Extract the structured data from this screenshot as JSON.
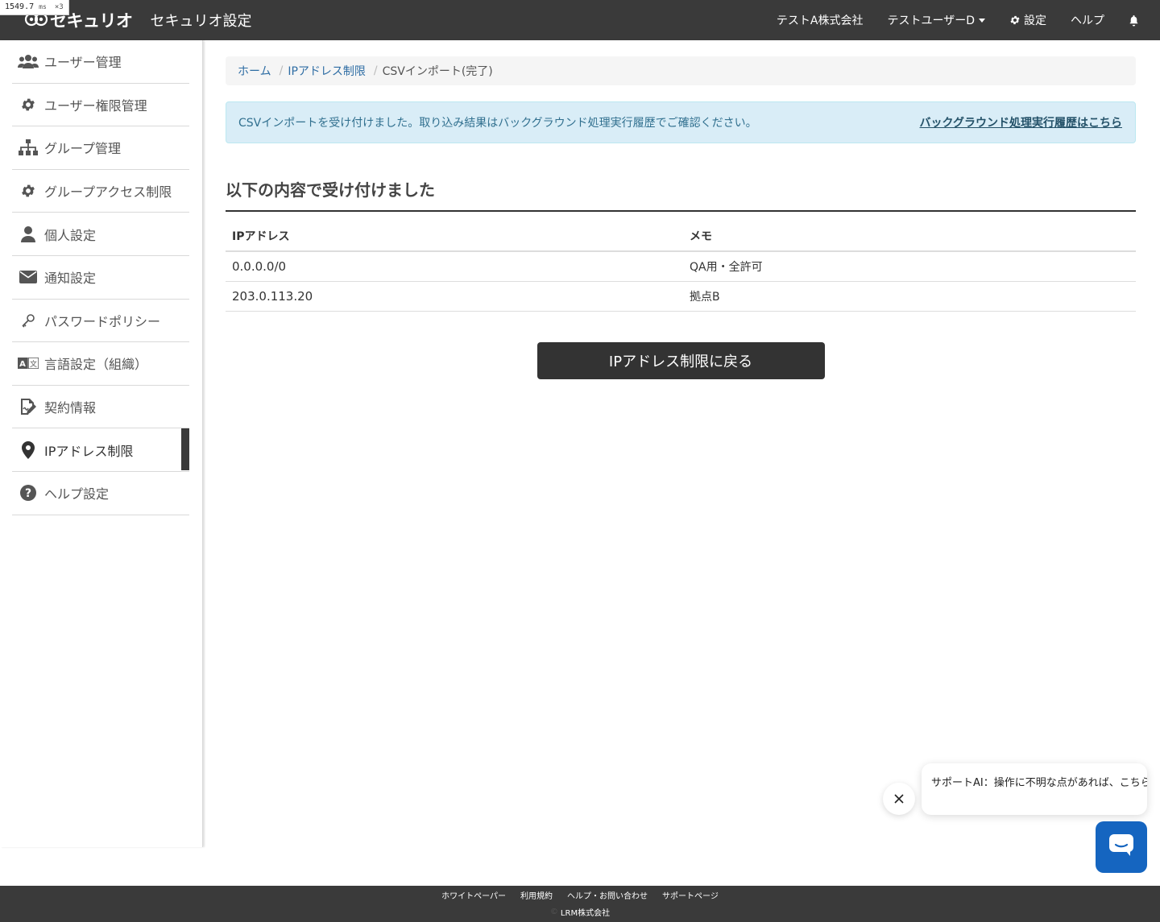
{
  "perf": {
    "value": "1549.7",
    "unit": "ms",
    "mult": "×3"
  },
  "header": {
    "brand": "セキュリオ",
    "title": "セキュリオ設定",
    "company": "テストA株式会社",
    "user": "テストユーザーD",
    "settings": "設定",
    "help": "ヘルプ",
    "icons": [
      "logo-icon",
      "gear-icon",
      "bell-icon"
    ]
  },
  "sidebar": {
    "items": [
      {
        "label": "ユーザー管理",
        "icon": "users-icon"
      },
      {
        "label": "ユーザー権限管理",
        "icon": "gear-icon"
      },
      {
        "label": "グループ管理",
        "icon": "sitemap-icon"
      },
      {
        "label": "グループアクセス制限",
        "icon": "gear-icon"
      },
      {
        "label": "個人設定",
        "icon": "user-icon"
      },
      {
        "label": "通知設定",
        "icon": "envelope-icon"
      },
      {
        "label": "パスワードポリシー",
        "icon": "key-icon"
      },
      {
        "label": "言語設定（組織）",
        "icon": "language-icon"
      },
      {
        "label": "契約情報",
        "icon": "contract-icon"
      },
      {
        "label": "IPアドレス制限",
        "icon": "map-marker-icon",
        "active": true
      },
      {
        "label": "ヘルプ設定",
        "icon": "question-circle-icon"
      }
    ]
  },
  "breadcrumb": {
    "home": "ホーム",
    "ip": "IPアドレス制限",
    "current": "CSVインポート(完了)",
    "separator": "/"
  },
  "alert": {
    "message": "CSVインポートを受け付けました。取り込み結果はバックグラウンド処理実行履歴でご確認ください。",
    "link": "バックグラウンド処理実行履歴はこちら"
  },
  "section": {
    "title": "以下の内容で受け付けました"
  },
  "table": {
    "headers": {
      "ip": "IPアドレス",
      "memo": "メモ"
    },
    "rows": [
      {
        "ip": "0.0.0.0/0",
        "memo": "QA用・全許可"
      },
      {
        "ip": "203.0.113.20",
        "memo": "拠点B"
      }
    ]
  },
  "back_button": "IPアドレス制限に戻る",
  "chat": {
    "message": "サポートAI：操作に不明な点があれば、こちらからお気軽にご質問ください。"
  },
  "footer": {
    "links": [
      "ホワイトペーパー",
      "利用規約",
      "ヘルプ・お問い合わせ",
      "サポートページ"
    ],
    "copy_symbol": "©",
    "company": "LRM株式会社"
  },
  "colors": {
    "header_bg": "#3a3a3a",
    "alert_bg": "#d9edf7",
    "alert_text": "#31708f",
    "link": "#2e6da4",
    "button_bg": "#333333",
    "chat_blue": "#1565c0"
  }
}
